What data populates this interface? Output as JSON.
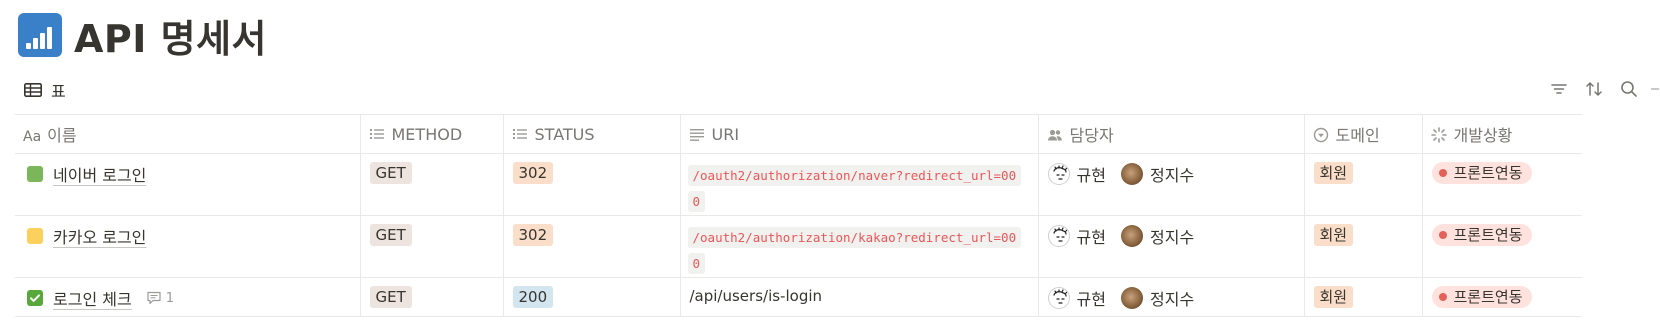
{
  "page": {
    "title": "API 명세서",
    "icon": "bar-chart-icon"
  },
  "view": {
    "label": "표",
    "icon": "table-icon"
  },
  "toolbar": {
    "icons": [
      "filter-icon",
      "sort-icon",
      "search-icon"
    ]
  },
  "columns": {
    "name": "이름",
    "method": "METHOD",
    "status": "STATUS",
    "uri": "URI",
    "owner": "담당자",
    "domain": "도메인",
    "dev": "개발상황"
  },
  "people": {
    "a": "규현",
    "b": "정지수"
  },
  "rows": [
    {
      "color": "#7bb65b",
      "name": "네이버 로그인",
      "method": "GET",
      "status": "302",
      "uri": "/oauth2/authorization/naver?redirect_url=000",
      "uri_is_code": true,
      "domain": "회원",
      "dev": "프론트연동",
      "comments": ""
    },
    {
      "color": "#fcd05c",
      "name": "카카오 로그인",
      "method": "GET",
      "status": "302",
      "uri": "/oauth2/authorization/kakao?redirect_url=000",
      "uri_is_code": true,
      "domain": "회원",
      "dev": "프론트연동",
      "comments": ""
    },
    {
      "color": "#58a83c",
      "name": "로그인 체크",
      "method": "GET",
      "status": "200",
      "uri": "/api/users/is-login",
      "uri_is_code": false,
      "domain": "회원",
      "dev": "프론트연동",
      "comments": "1"
    }
  ],
  "colors": {
    "accent": "#3a80c9",
    "code_text": "#eb5757",
    "dev_dot": "#e16259"
  }
}
